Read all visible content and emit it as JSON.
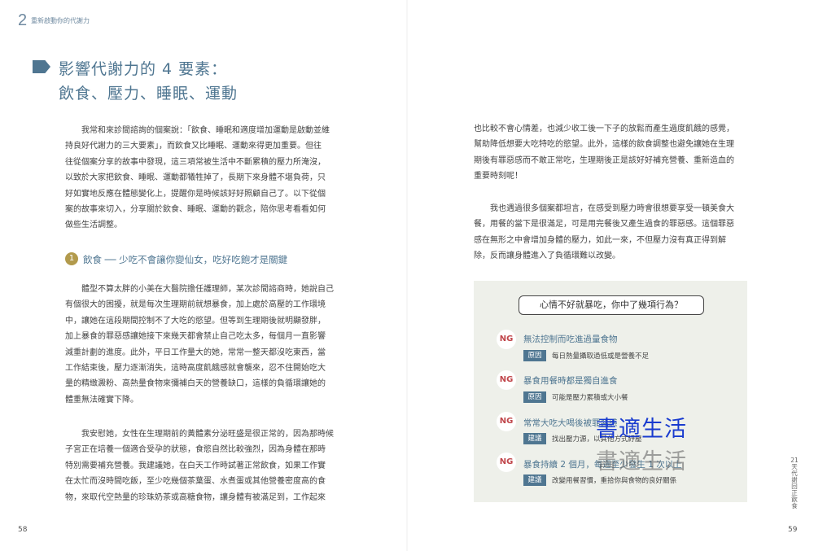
{
  "header": {
    "chapter_number": "2",
    "chapter_title": "重新啟動你的代謝力"
  },
  "heading": {
    "line1": "影響代謝力的 4 要素：",
    "line2": "飲食、壓力、睡眠、運動"
  },
  "left": {
    "intro": [
      "我常和來診間諮詢的個案說：「飲食、睡眠和適度增加運動是啟動並維",
      "持良好代謝力的三大要素」，而飲食又比睡眠、運動來得更加重要。但往",
      "往從個案分享的故事中發現，這三項常被生活中不斷累積的壓力所淹沒，",
      "以致於大家把飲食、睡眠、運動都犧牲掉了，長期下來身體不堪負荷，只",
      "好如實地反應在體態變化上，提醒你是時候該好好照顧自己了。以下從個",
      "案的故事來切入，分享關於飲食、睡眠、運動的觀念，陪你思考看看如何",
      "做些生活調整。"
    ],
    "section": {
      "number": "1",
      "title": "飲食 ── 少吃不會讓你變仙女，吃好吃飽才是關鍵"
    },
    "para2": [
      "體型不算太胖的小美在大醫院擔任護理師，某次診間諮商時，她說自己",
      "有個很大的困擾，就是每次生理期前就想暴食，加上處於高壓的工作環境",
      "中，讓她在這段期間控制不了大吃的慾望。但等到生理期後就明顯發胖，",
      "加上暴食的罪惡感讓她接下來幾天都會禁止自己吃太多，每個月一直影響",
      "減重計劃的進度。此外，平日工作量大的她，常常一整天都沒吃東西，當",
      "工作結束後，壓力逐漸消失，這時高度飢餓感就會襲來，忍不住開始吃大",
      "量的精緻澱粉、高熱量食物來彌補白天的營養缺口，這樣的負循環讓她的",
      "體重無法確實下降。"
    ],
    "para3": [
      "我安慰她，女性在生理期前的黃體素分泌旺盛是很正常的，因為那時候",
      "子宮正在培養一個適合受孕的狀態，食慾自然比較強烈，因為身體在那時",
      "特別需要補充營養。我建議她，在白天工作時試著正常飲食，如果工作實",
      "在太忙而沒時間吃飯，至少吃幾個茶葉蛋、水煮蛋或其他營養密度高的食",
      "物，來取代空熱量的珍珠奶茶或高糖食物，讓身體有被滿足到，工作起來"
    ],
    "page_number": "58"
  },
  "right": {
    "para1": [
      "也比較不會心情差，也減少收工後一下子的放鬆而產生過度飢餓的感覺，",
      "幫助降低想要大吃特吃的慾望。此外，這樣的飲食調整也避免讓她在生理",
      "期後有罪惡感而不敢正常吃，生理期後正是該好好補充營養、重新造血的",
      "重要時刻呢！"
    ],
    "para2": [
      "我也遇過很多個案都坦言，在感受到壓力時會很想要享受一頓美食大",
      "餐，用餐的當下是很滿足，可是用完餐後又產生過食的罪惡感。這個罪惡",
      "感在無形之中會增加身體的壓力，如此一來，不但壓力沒有真正得到解",
      "除，反而讓身體進入了負循環難以改變。"
    ],
    "box": {
      "title": "心情不好就暴吃，你中了幾項行為？",
      "items": [
        {
          "badge": "NG",
          "text": "無法控制而吃進過量食物",
          "label": "原因",
          "note": "每日熱量攝取過低或是營養不足"
        },
        {
          "badge": "NG",
          "text": "暴食用餐時都是獨自進食",
          "label": "原因",
          "note": "可能是壓力累積或大小餐"
        },
        {
          "badge": "NG",
          "text": "常常大吃大喝後被罪惡感",
          "label": "建議",
          "note": "找出壓力源，以其他方式紓壓"
        },
        {
          "badge": "NG",
          "text": "暴食持續 2 個月，每週至少發生 1 次以上",
          "label": "建議",
          "note": "改變用餐習慣，重拾你與食物的良好關係"
        }
      ]
    },
    "side_tab": "21天代謝回正飲食",
    "page_number": "59"
  },
  "watermark": {
    "line1": "書適生活",
    "line2": "書適生活"
  }
}
